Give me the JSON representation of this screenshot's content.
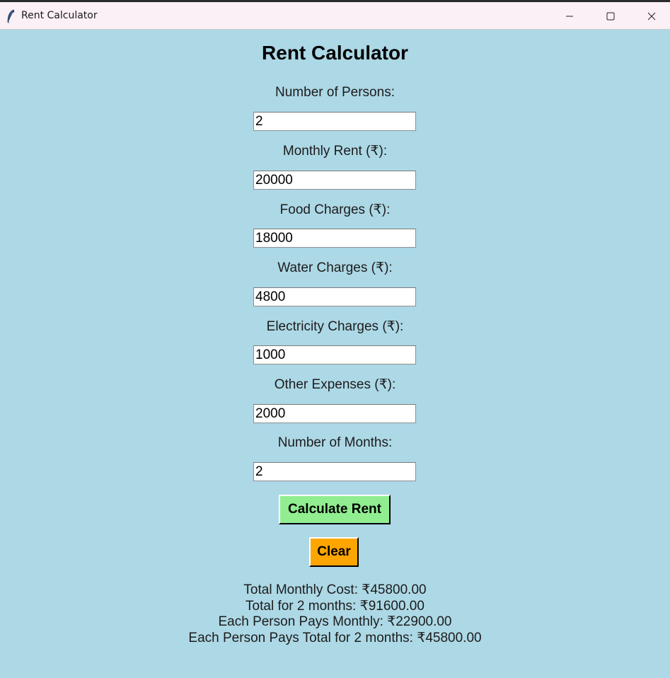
{
  "window": {
    "title": "Rent Calculator",
    "controls": [
      "minimize-icon",
      "maximize-icon",
      "close-icon"
    ]
  },
  "heading": "Rent Calculator",
  "fields": [
    {
      "label": "Number of Persons:",
      "value": "2"
    },
    {
      "label": "Monthly Rent (₹):",
      "value": "20000"
    },
    {
      "label": "Food Charges (₹):",
      "value": "18000"
    },
    {
      "label": "Water Charges (₹):",
      "value": "4800"
    },
    {
      "label": "Electricity Charges (₹):",
      "value": "1000"
    },
    {
      "label": "Other Expenses (₹):",
      "value": "2000"
    },
    {
      "label": "Number of Months:",
      "value": "2"
    }
  ],
  "buttons": {
    "calculate": "Calculate Rent",
    "clear": "Clear"
  },
  "colors": {
    "background": "#add8e6",
    "calculate_button": "#90ee90",
    "clear_button": "#ffa500"
  },
  "results": [
    "Total Monthly Cost: ₹45800.00",
    "Total for 2 months: ₹91600.00",
    "Each Person Pays Monthly: ₹22900.00",
    "Each Person Pays Total for 2 months: ₹45800.00"
  ]
}
